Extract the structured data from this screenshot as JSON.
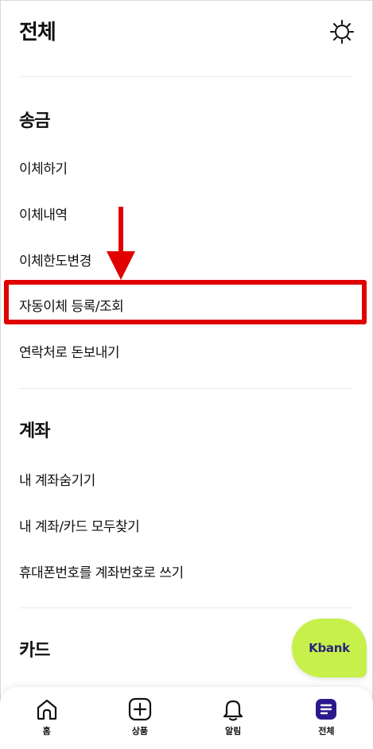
{
  "header": {
    "title": "전체"
  },
  "sections": [
    {
      "title": "송금",
      "items": [
        "이체하기",
        "이체내역",
        "이체한도변경",
        "자동이체 등록/조회",
        "연락처로 돈보내기"
      ]
    },
    {
      "title": "계좌",
      "items": [
        "내 계좌숨기기",
        "내 계좌/카드 모두찾기",
        "휴대폰번호를 계좌번호로 쓰기"
      ]
    },
    {
      "title": "카드",
      "items": []
    }
  ],
  "floating_button": {
    "label": "Kbank",
    "color": "#c8f04a"
  },
  "tabbar": {
    "tabs": [
      {
        "label": "홈",
        "icon": "home-icon"
      },
      {
        "label": "상품",
        "icon": "plus-square-icon"
      },
      {
        "label": "알림",
        "icon": "bell-icon"
      },
      {
        "label": "전체",
        "icon": "menu-list-icon",
        "active": true
      }
    ]
  },
  "colors": {
    "highlight": "#e00000",
    "active_tab": "#2b1a8c",
    "kbank_text": "#2a2578"
  }
}
